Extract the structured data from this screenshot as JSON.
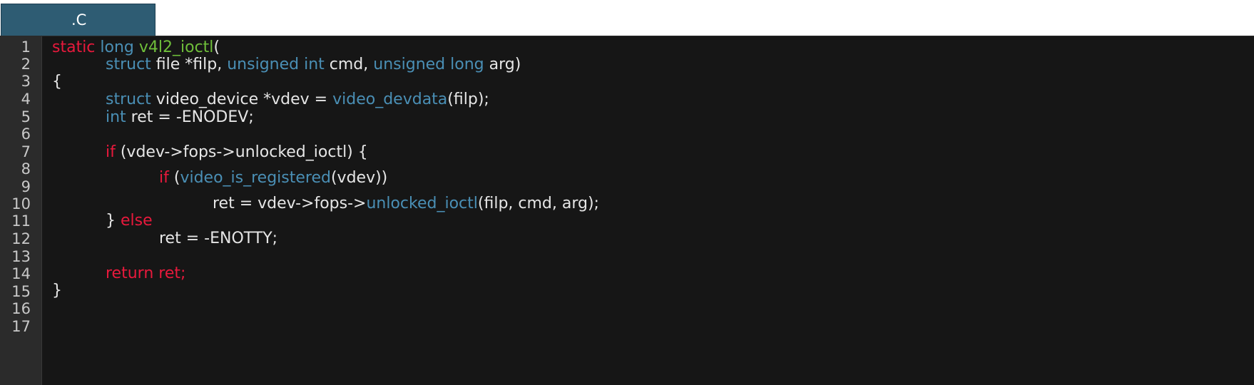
{
  "tab": {
    "label": ".C"
  },
  "gutter": {
    "line_numbers": [
      "1",
      "2",
      "3",
      "4",
      "5",
      "6",
      "7",
      "8",
      "9",
      "10",
      "11",
      "12",
      "13",
      "14",
      "15",
      "16",
      "17"
    ]
  },
  "code": {
    "l1": {
      "k": "static",
      "t": "long",
      "fn": "v4l2_ioctl",
      "rest": "("
    },
    "l2": {
      "t1": "struct",
      "a": " file *filp, ",
      "t2": "unsigned int",
      "b": " cmd, ",
      "t3": "unsigned long",
      "c": " arg)"
    },
    "l3": {
      "text": "{"
    },
    "l4": {
      "t": "struct",
      "a": " video_device *vdev = ",
      "fn": "video_devdata",
      "b": "(filp);"
    },
    "l5": {
      "t": "int",
      "a": " ret = -ENODEV;"
    },
    "l7": {
      "k": "if",
      "a": " (vdev->fops->unlocked_ioctl) {"
    },
    "l8": {
      "k": "if",
      "a": " (",
      "fn": "video_is_registered",
      "b": "(vdev))"
    },
    "l10": {
      "a": "ret = vdev->fops->",
      "fn": "unlocked_ioctl",
      "b": "(filp, cmd, arg);"
    },
    "l11": {
      "a": "} ",
      "k": "else"
    },
    "l12": {
      "a": "ret = -ENOTTY;"
    },
    "l14": {
      "k": "return ret;"
    },
    "l15": {
      "text": "}"
    }
  },
  "colors": {
    "keyword": "#e8193c",
    "type": "#4a8fb5",
    "function": "#4a8fb5",
    "defined_function": "#6fbf3a",
    "text": "#e6e6e6",
    "tab": "#2e5c73"
  }
}
